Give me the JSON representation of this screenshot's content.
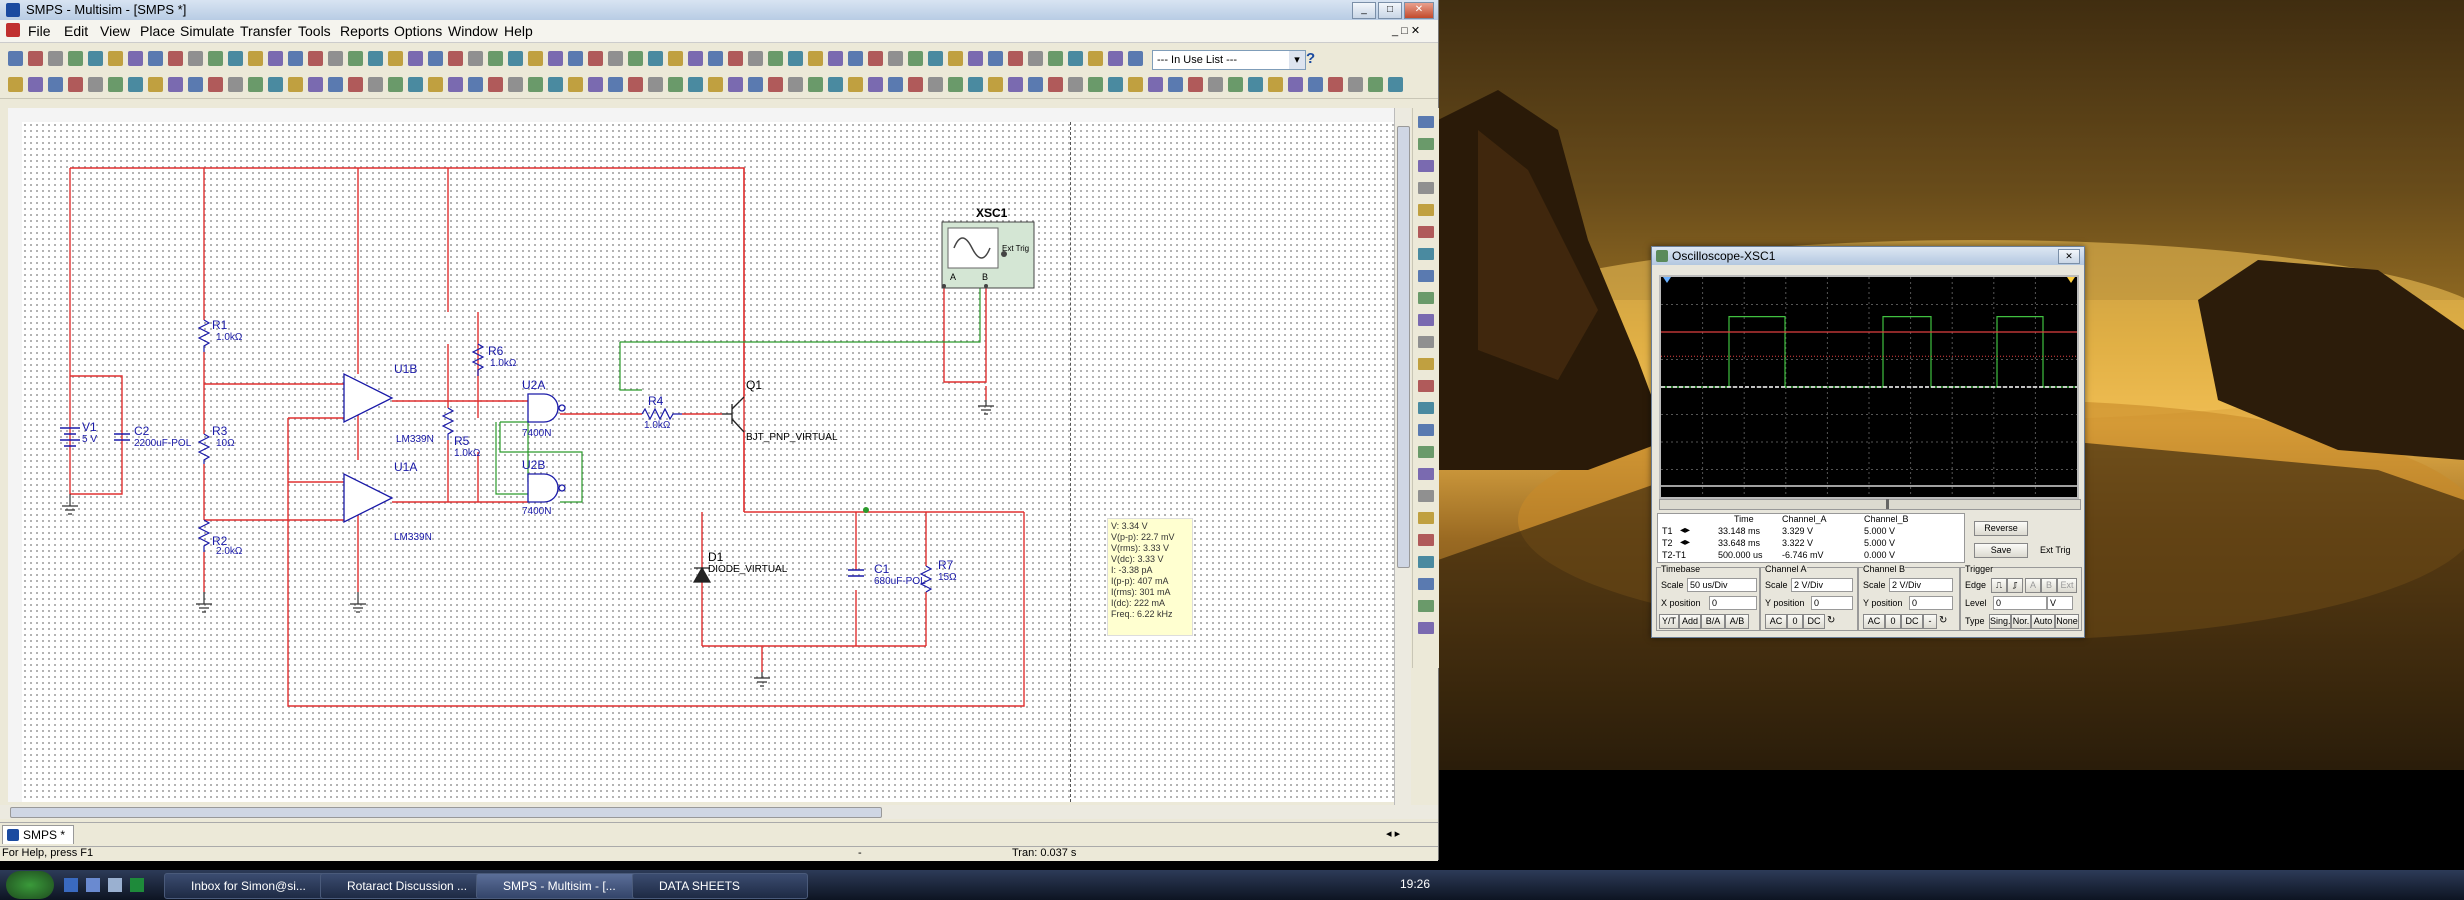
{
  "multisim": {
    "title": "SMPS - Multisim - [SMPS *]",
    "menus": [
      "File",
      "Edit",
      "View",
      "Place",
      "Simulate",
      "Transfer",
      "Tools",
      "Reports",
      "Options",
      "Window",
      "Help"
    ],
    "in_use_list": "--- In Use List ---",
    "doc_tab": "SMPS *",
    "status_left": "For Help, press F1",
    "status_mid": "-",
    "status_tran": "Tran: 0.037 s"
  },
  "schematic": {
    "labels": {
      "r1": "R1",
      "r1_val": "1.0kΩ",
      "r3": "R3",
      "r3_val": "10Ω",
      "r2": "R2",
      "r2_val": "2.0kΩ",
      "r6": "R6",
      "r6_val": "1.0kΩ",
      "r5": "R5",
      "r5_val": "1.0kΩ",
      "r4": "R4",
      "r4_val": "1.0kΩ",
      "r7": "R7",
      "r7_val": "15Ω",
      "v1": "V1",
      "v1_val": "5 V",
      "c2": "C2",
      "c2_val": "2200uF-POL",
      "c1": "C1",
      "c1_val": "680uF-POL",
      "u1b": "U1B",
      "u1a": "U1A",
      "lm1": "LM339N",
      "lm2": "LM339N",
      "u2a": "U2A",
      "u2b": "U2B",
      "g1": "7400N",
      "g2": "7400N",
      "q1": "Q1",
      "q1_val": "BJT_PNP_VIRTUAL",
      "d1": "D1",
      "d1_val": "DIODE_VIRTUAL",
      "xsc1": "XSC1",
      "ext_trig": "Ext Trig",
      "ch_a": "A",
      "ch_b": "B"
    },
    "probe": [
      "V: 3.34 V",
      "V(p-p): 22.7 mV",
      "V(rms): 3.33 V",
      "V(dc): 3.33 V",
      "I: -3.38 pA",
      "I(p-p): 407 mA",
      "I(rms): 301 mA",
      "I(dc): 222 mA",
      "Freq.: 6.22 kHz"
    ]
  },
  "oscilloscope": {
    "title": "Oscilloscope-XSC1",
    "hdr_time": "Time",
    "hdr_cha": "Channel_A",
    "hdr_chb": "Channel_B",
    "rows": [
      {
        "label": "T1",
        "time": "33.148 ms",
        "cha": "3.329 V",
        "chb": "5.000 V"
      },
      {
        "label": "T2",
        "time": "33.648 ms",
        "cha": "3.322 V",
        "chb": "5.000 V"
      },
      {
        "label": "T2-T1",
        "time": "500.000 us",
        "cha": "-6.746 mV",
        "chb": "0.000 V"
      }
    ],
    "reverse": "Reverse",
    "save": "Save",
    "ext_trig": "Ext Trig",
    "timebase_title": "Timebase",
    "timebase_scale_label": "Scale",
    "timebase_scale": "50 us/Div",
    "xpos_label": "X position",
    "xpos": "0",
    "cha_title": "Channel A",
    "cha_scale_label": "Scale",
    "cha_scale": "2 V/Div",
    "cha_ypos_label": "Y position",
    "cha_ypos": "0",
    "chb_title": "Channel B",
    "chb_scale_label": "Scale",
    "chb_scale": "2 V/Div",
    "chb_ypos_label": "Y position",
    "chb_ypos": "0",
    "trig_title": "Trigger",
    "edge_label": "Edge",
    "level_label": "Level",
    "level": "0",
    "level_unit": "V",
    "type_label": "Type",
    "mode_buttons": [
      "Y/T",
      "Add",
      "B/A",
      "A/B"
    ],
    "coupling_a": [
      "AC",
      "0",
      "DC"
    ],
    "coupling_b": [
      "AC",
      "0",
      "DC",
      "-"
    ],
    "type_buttons": [
      "Sing.",
      "Nor.",
      "Auto",
      "None"
    ],
    "trig_src": [
      "A",
      "B",
      "Ext"
    ],
    "colors": {
      "cha": "#e04040",
      "chb": "#40c040"
    }
  },
  "taskbar": {
    "tasks": [
      "Inbox for Simon@si...",
      "Rotaract Discussion ...",
      "SMPS - Multisim - [...",
      "DATA SHEETS"
    ],
    "clock": "19:26"
  }
}
